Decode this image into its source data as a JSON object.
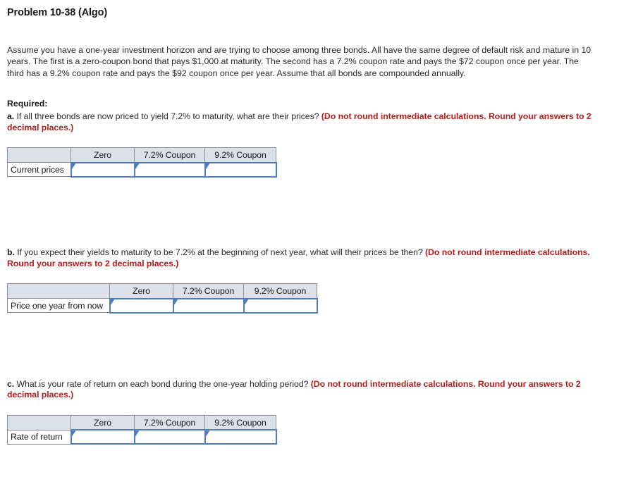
{
  "problem": {
    "title": "Problem 10-38 (Algo)",
    "intro": "Assume you have a one-year investment horizon and are trying to choose among three bonds. All have the same degree of default risk and mature in 10 years. The first is a zero-coupon bond that pays $1,000 at maturity. The second has a 7.2% coupon rate and pays the $72 coupon once per year. The third has a 9.2% coupon rate and pays the $92 coupon once per year. Assume that all bonds are compounded annually."
  },
  "required": {
    "label": "Required:",
    "parts": [
      {
        "letter": "a.",
        "text": " If all three bonds are now priced to yield 7.2% to maturity, what are their prices? ",
        "note": "(Do not round intermediate calculations. Round your answers to 2 decimal places.)"
      },
      {
        "letter": "b.",
        "text": " If you expect their yields to maturity to be 7.2% at the beginning of next year, what will their prices be then? ",
        "note": "(Do not round intermediate calculations. Round your answers to 2 decimal places.)"
      },
      {
        "letter": "c.",
        "text": " What is your rate of return on each bond during the one-year holding period? ",
        "note": "(Do not round intermediate calculations. Round your answers to 2 decimal places.)"
      }
    ]
  },
  "tables": {
    "a": {
      "corner": "",
      "columns": [
        "Zero",
        "7.2% Coupon",
        "9.2% Coupon"
      ],
      "row_label": "Current prices",
      "values": [
        "",
        "",
        ""
      ],
      "placeholders": [
        "",
        "",
        ""
      ]
    },
    "b": {
      "corner": "",
      "columns": [
        "Zero",
        "7.2% Coupon",
        "9.2% Coupon"
      ],
      "row_label": "Price one year from now",
      "values": [
        "",
        "",
        ""
      ],
      "placeholders": [
        "",
        "",
        ""
      ]
    },
    "c": {
      "corner": "",
      "columns": [
        "Zero",
        "7.2% Coupon",
        "9.2% Coupon"
      ],
      "row_label": "Rate of return",
      "values": [
        "",
        "",
        ""
      ],
      "placeholders": [
        "",
        "",
        ""
      ]
    }
  },
  "colors": {
    "note_red": "#b71c1c",
    "header_fill": "#dce0e8",
    "table_border": "#8d8d96",
    "input_border": "#4d7ebf",
    "body_text": "#2b2b2b"
  }
}
